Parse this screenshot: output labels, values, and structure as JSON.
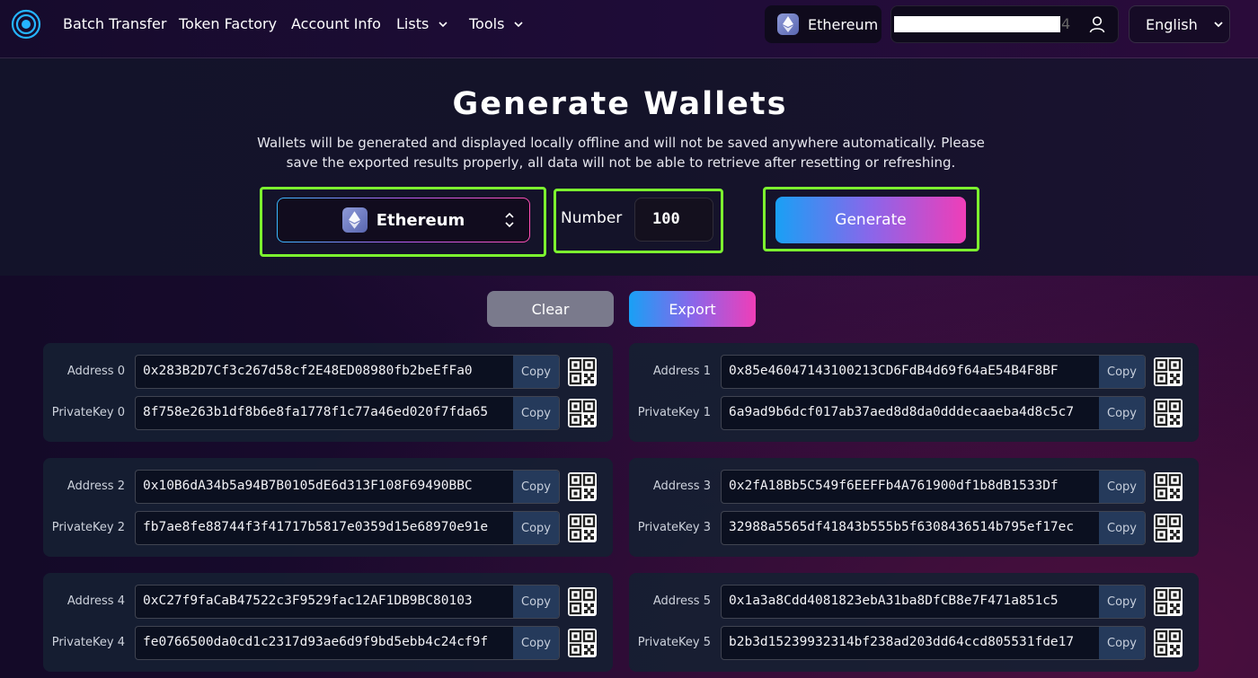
{
  "nav": {
    "links": [
      "Batch Transfer",
      "Token Factory",
      "Account Info",
      "Lists",
      "Tools"
    ],
    "network": "Ethereum",
    "account_suffix": "4",
    "language": "English"
  },
  "hero": {
    "title": "Generate Wallets",
    "description": "Wallets will be generated and displayed locally offline and will not be saved anywhere automatically. Please save the exported results properly, all data will not be able to retrieve after resetting or refreshing.",
    "chain_select": "Ethereum",
    "number_label": "Number",
    "number_value": "100",
    "generate_label": "Generate"
  },
  "actions": {
    "clear_label": "Clear",
    "export_label": "Export"
  },
  "copy_label": "Copy",
  "colors": {
    "highlight": "#7cf52f",
    "accent_start": "#19a0f5",
    "accent_end": "#ef3eb8"
  },
  "wallets": [
    {
      "address_label": "Address 0",
      "key_label": "PrivateKey 0",
      "address": "0x283B2D7Cf3c267d58cf2E48ED08980fb2beEfFa0",
      "private_key": "8f758e263b1df8b6e8fa1778f1c77a46ed020f7fda65"
    },
    {
      "address_label": "Address 1",
      "key_label": "PrivateKey 1",
      "address": "0x85e46047143100213CD6FdB4d69f64aE54B4F8BF",
      "private_key": "6a9ad9b6dcf017ab37aed8d8da0dddecaaeba4d8c5c7"
    },
    {
      "address_label": "Address 2",
      "key_label": "PrivateKey 2",
      "address": "0x10B6dA34b5a94B7B0105dE6d313F108F69490BBC",
      "private_key": "fb7ae8fe88744f3f41717b5817e0359d15e68970e91e"
    },
    {
      "address_label": "Address 3",
      "key_label": "PrivateKey 3",
      "address": "0x2fA18Bb5C549f6EEFFb4A761900df1b8dB1533Df",
      "private_key": "32988a5565df41843b555b5f6308436514b795ef17ec"
    },
    {
      "address_label": "Address 4",
      "key_label": "PrivateKey 4",
      "address": "0xC27f9faCaB47522c3F9529fac12AF1DB9BC80103",
      "private_key": "fe0766500da0cd1c2317d93ae6d9f9bd5ebb4c24cf9f"
    },
    {
      "address_label": "Address 5",
      "key_label": "PrivateKey 5",
      "address": "0x1a3a8Cdd4081823ebA31ba8DfCB8e7F471a851c5",
      "private_key": "b2b3d15239932314bf238ad203dd64ccd805531fde17"
    }
  ]
}
